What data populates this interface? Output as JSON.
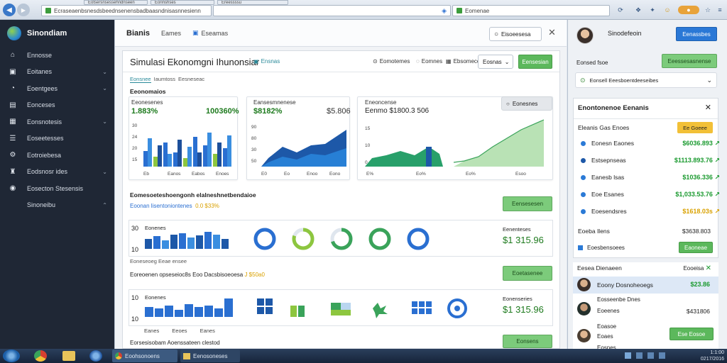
{
  "browser": {
    "tabs": [
      "Eotsersnsessehndnseen",
      "Eorinshses",
      "Ereessssu"
    ],
    "address": "Ecraseaenbsnesdsbeednsenensbadbaasndnisasnnesienn",
    "address2": "Eomenae"
  },
  "sidebar": {
    "brand": "Sinondiam",
    "items": [
      {
        "label": "Ennosse",
        "icon": "home-icon"
      },
      {
        "label": "Eoitanes",
        "icon": "monitor-icon",
        "chevron": "⌄"
      },
      {
        "label": "Eoentgees",
        "icon": "clock-icon",
        "chevron": "⌄"
      },
      {
        "label": "Eonceses",
        "icon": "doc-icon"
      },
      {
        "label": "Eonsnotesis",
        "icon": "grid-icon",
        "chevron": "⌄"
      },
      {
        "label": "Eoseetesses",
        "icon": "list-icon"
      },
      {
        "label": "Eotroiebesa",
        "icon": "filter-icon"
      },
      {
        "label": "Eodsnosr ides",
        "icon": "users-icon",
        "chevron": "⌄"
      },
      {
        "label": "Eosecton Stesensis",
        "icon": "info-icon"
      },
      {
        "label": "Sinoneibu",
        "icon": "",
        "chevron": "⌃"
      }
    ]
  },
  "main_top": {
    "title": "Bianis",
    "tab1": "Eames",
    "tab2": "Eseamas",
    "search_btn": "Eisoeesesa",
    "close": "✕"
  },
  "page": {
    "title": "Simulasi Ekonomgni Ihunonsiar",
    "tag": "Ensnas",
    "link1": "Eomotemes",
    "link2": "Eomnes",
    "link3": "Ebsomeces",
    "select": "Eosnas",
    "green_btn": "Eensesian",
    "subtabs": [
      "Eonsnee",
      "Iaumtoss",
      "Eesneseac"
    ],
    "section1": "Eeonomaios"
  },
  "cards": [
    {
      "label": "Eeonesenes",
      "stat_left": "1.883%",
      "stat_right": "100360%",
      "xticks": [
        "Eb",
        "Eanos",
        "Eabos",
        "Enoes"
      ],
      "yticks": [
        "30",
        "24",
        "20",
        "15"
      ]
    },
    {
      "label": "Eansesmnenese",
      "stat_left": "$8182%",
      "stat_right": "$5.806",
      "xticks": [
        "E0",
        "Eo",
        "Enoo",
        "Eono"
      ],
      "yticks": [
        "90",
        "80",
        "30",
        "50"
      ]
    },
    {
      "label": "Eneoncense",
      "stat_left": "Eenmo $1800.3 506",
      "stat_right": "",
      "xticks": [
        "E%",
        "Eo%",
        "Eo%",
        "Esoo"
      ],
      "yticks": [
        "15",
        "10",
        "0"
      ],
      "pill": "Eonesnes"
    }
  ],
  "section2": {
    "title": "Eomesoeteshoengonh elalneshnetbendaioe",
    "sub": "Eoonan lisentoniontenes",
    "sub_nums": "0.0 $33%",
    "green_btn": "Eensesesen",
    "row_label": "Eonenes",
    "row_tick": "30",
    "row_tick2": "10",
    "right_label": "Eenenteses",
    "right_value": "$1 315.96"
  },
  "section3": {
    "title": "Eosneneeter Edoiar",
    "sub": "Eoreoenen opseseioc8s Eoo Dacsbisoeoesa",
    "sub_num": "J $50a0",
    "caption": "Eoneseoeg Eeae ensee",
    "green_btn": "Eoetasenee",
    "row_label": "Eonenes",
    "row_tick": "10",
    "row_tick2": "10",
    "right_label": "Eonenseries",
    "right_value": "$1 315.96",
    "legend": [
      "Eanes",
      "Eeoes",
      "Eanes"
    ],
    "bottom": "Eorsesisobam Aoenssateen clestod",
    "bottom_btn": "Eonsens"
  },
  "rpanel": {
    "name": "Sinodefeoin",
    "btn_blue": "Eenassbes",
    "row_label": "Eonsed fsoe",
    "btn_green": "Eeessesasnense",
    "search": "Eonsell Eeesboentdeeseibes",
    "list_title": "Enontonenoe Eenanis",
    "list_close": "✕",
    "first_row": "Eleanis Gas Enoes",
    "first_badge": "Ee Goeee",
    "rows": [
      {
        "label": "Eonesn Eaones",
        "value": "$6036.893",
        "color": "#2b7ad6",
        "val_color": "#1a9a2f",
        "arrow": "↗"
      },
      {
        "label": "Estsepnseas",
        "value": "$1113.893.76",
        "color": "#1d58a8",
        "val_color": "#1a9a2f",
        "arrow": "↗"
      },
      {
        "label": "Eanesb lsas",
        "value": "$1036.336",
        "color": "#2b7ad6",
        "val_color": "#1a9a2f",
        "arrow": "↗"
      },
      {
        "label": "Eoe Esanes",
        "value": "$1,033.53.76",
        "color": "#2b7ad6",
        "val_color": "#1a9a2f",
        "arrow": "↗"
      },
      {
        "label": "Eoesendsres",
        "value": "$1618.03s",
        "color": "#2b7ad6",
        "val_color": "#d9a100",
        "arrow": "↗"
      }
    ],
    "sum_label": "Eoeba Ilens",
    "sum_value": "$3638.803",
    "detail_label": "Eoesbensoees",
    "detail_btn": "Eaoneae",
    "people_title": "Eesea Dienaeen",
    "people_action": "Eooeisa",
    "people": [
      {
        "name": "Eoony Dosnoheoegs",
        "value": "$23.86",
        "highlight": true
      },
      {
        "name": "Eosseenbe Dnes",
        "sub": "Eoeenes",
        "value": "$431806"
      },
      {
        "name": "Eoasoe",
        "sub": "Eoaes",
        "value": "",
        "btn": "Ese Eosoe"
      },
      {
        "name": "Eosnes",
        "value": ""
      }
    ]
  },
  "taskbar": {
    "items": [
      "Eoohsonoens",
      "Eenosoneses"
    ],
    "clock": "1:1:00",
    "date": "0217/2016"
  },
  "colors": {
    "blue": "#2a6fd1",
    "dark_blue": "#1d4f9a",
    "green": "#5cb85c",
    "lime": "#8dc63f",
    "yellow": "#f2c037"
  }
}
